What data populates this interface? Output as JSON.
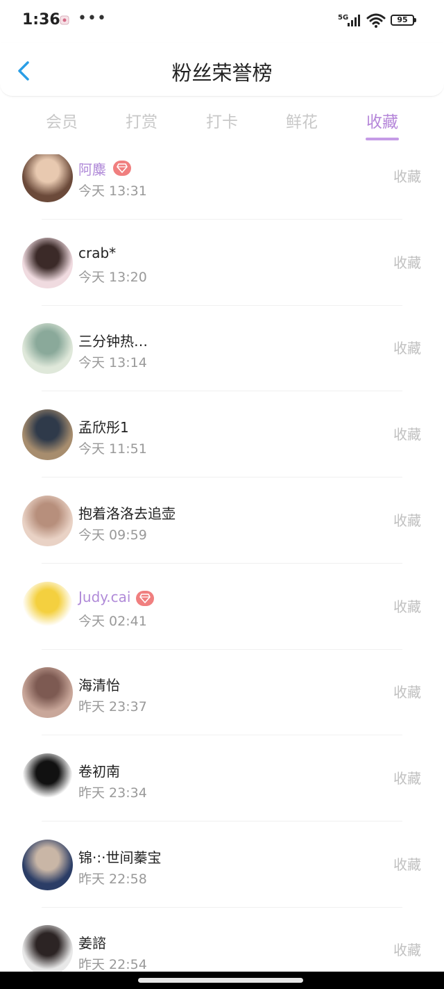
{
  "status_bar": {
    "time": "1:36",
    "more": "•••",
    "network": "5G",
    "battery": "95"
  },
  "header": {
    "title": "粉丝荣誉榜"
  },
  "tabs": [
    {
      "label": "会员",
      "active": false
    },
    {
      "label": "打赏",
      "active": false
    },
    {
      "label": "打卡",
      "active": false
    },
    {
      "label": "鲜花",
      "active": false
    },
    {
      "label": "收藏",
      "active": true
    }
  ],
  "list": [
    {
      "name": "阿麋",
      "time": "今天 13:31",
      "action": "收藏",
      "vip": true,
      "avatar_colors": [
        "#6b4a3a",
        "#e8c9b0"
      ]
    },
    {
      "name": "crab*",
      "time": "今天 13:20",
      "action": "收藏",
      "vip": false,
      "avatar_colors": [
        "#f0dbe0",
        "#3b2a28"
      ]
    },
    {
      "name": "三分钟热…",
      "time": "今天 13:14",
      "action": "收藏",
      "vip": false,
      "avatar_colors": [
        "#dfe8da",
        "#8aa99a"
      ]
    },
    {
      "name": "孟欣彤1",
      "time": "今天 11:51",
      "action": "收藏",
      "vip": false,
      "avatar_colors": [
        "#a78d6e",
        "#2f3a4a"
      ]
    },
    {
      "name": "抱着洛洛去追壶",
      "time": "今天 09:59",
      "action": "收藏",
      "vip": false,
      "avatar_colors": [
        "#e9d2c5",
        "#b78f7c"
      ]
    },
    {
      "name": "Judy.cai",
      "time": "今天 02:41",
      "action": "收藏",
      "vip": true,
      "avatar_colors": [
        "#ffffff",
        "#f4d03f"
      ]
    },
    {
      "name": "海清怡",
      "time": "昨天 23:37",
      "action": "收藏",
      "vip": false,
      "avatar_colors": [
        "#c9a79a",
        "#7d5a52"
      ]
    },
    {
      "name": "卷初南",
      "time": "昨天 23:34",
      "action": "收藏",
      "vip": false,
      "avatar_colors": [
        "#ffffff",
        "#111111"
      ]
    },
    {
      "name": "锦·:·世间蓁宝",
      "time": "昨天 22:58",
      "action": "收藏",
      "vip": false,
      "avatar_colors": [
        "#2b3d66",
        "#c9b6a6"
      ]
    },
    {
      "name": "姜諮",
      "time": "昨天 22:54",
      "action": "收藏",
      "vip": false,
      "avatar_colors": [
        "#e8e8e8",
        "#2c2424"
      ]
    }
  ],
  "colors": {
    "accent": "#b586d9",
    "vip_name": "#b08ad8",
    "badge": "#f07f7f",
    "back": "#2a9ee6"
  }
}
